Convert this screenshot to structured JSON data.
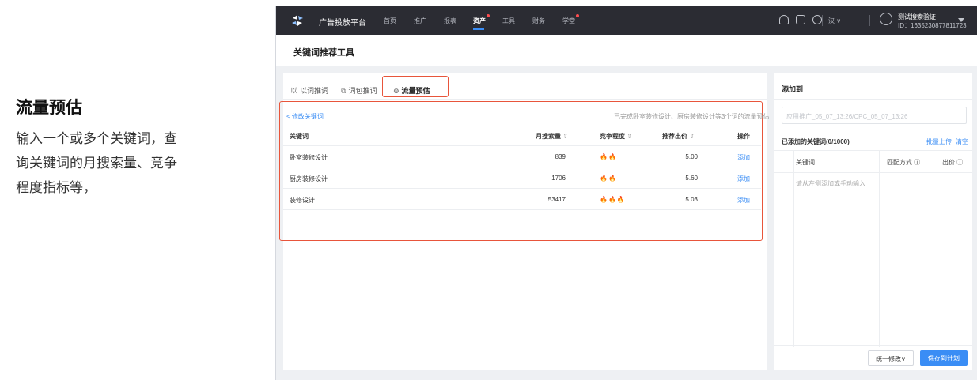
{
  "caption": {
    "title": "流量预估",
    "lines": [
      "输入一个或多个关键词，查",
      "询关键词的月搜索量、竞争",
      "程度指标等，"
    ]
  },
  "topbar": {
    "platform": "广告投放平台",
    "nav": [
      "首页",
      "推广",
      "报表",
      "资产",
      "工具",
      "财务",
      "学堂"
    ],
    "active_nav": "资产",
    "lang": "汉 ∨",
    "user_name": "测试搜索验证",
    "user_id": "ID：1635230877811723"
  },
  "page_title": "关键词推荐工具",
  "tabs": [
    {
      "icon": "以",
      "label": "以词推词"
    },
    {
      "icon": "⧉",
      "label": "词包推词"
    },
    {
      "icon": "⊖",
      "label": "流量预估"
    }
  ],
  "active_tab": "流量预估",
  "results": {
    "back_link": "< 修改关键词",
    "info": "已完成卧室装修设计、厨房装修设计等3个词的流量预估",
    "columns": {
      "keyword": "关键词",
      "volume": "月搜索量",
      "competition": "竞争程度",
      "bid": "推荐出价",
      "action": "操作"
    },
    "sort_icon": "⇕",
    "rows": [
      {
        "keyword": "卧室装修设计",
        "volume": "839",
        "competition": "🔥🔥",
        "bid": "5.00",
        "action": "添加"
      },
      {
        "keyword": "厨房装修设计",
        "volume": "1706",
        "competition": "🔥🔥",
        "bid": "5.60",
        "action": "添加"
      },
      {
        "keyword": "装修设计",
        "volume": "53417",
        "competition": "🔥🔥🔥",
        "bid": "5.03",
        "action": "添加"
      }
    ]
  },
  "side": {
    "title": "添加到",
    "plan_placeholder": "应用推广_05_07_13:26/CPC_05_07_13:26",
    "added_label": "已添加的关键词(0/1000)",
    "batch_upload": "批量上传",
    "clear": "清空",
    "columns": {
      "keyword": "关键词",
      "match": "匹配方式 ⓘ",
      "bid": "出价 ⓘ"
    },
    "empty_placeholder": "请从左侧添加或手动输入",
    "bulk_edit": "统一修改∨",
    "save": "保存到计划"
  },
  "colors": {
    "accent": "#3a8df5",
    "highlight": "#e8553b",
    "topbar": "#2b2c33",
    "flame": "#f08a24"
  }
}
